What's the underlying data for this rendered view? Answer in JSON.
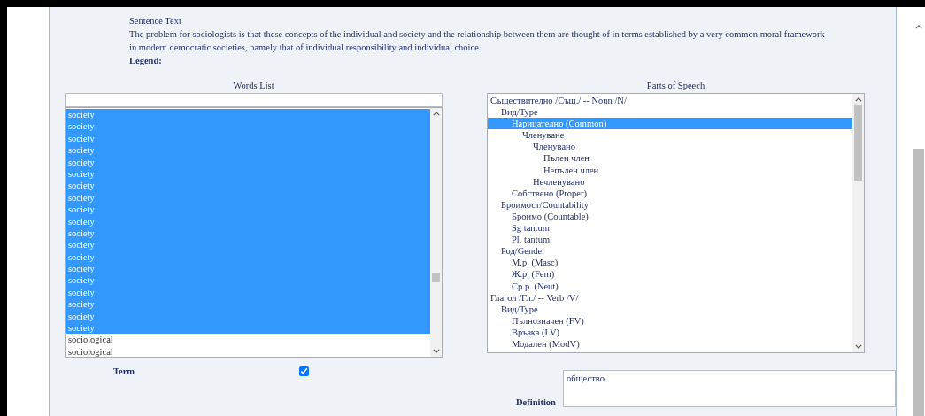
{
  "sentence": {
    "heading": "Sentence Text",
    "text": "The problem for sociologists is that these concepts of the individual and society and the relationship between them are thought of in terms established by a very common moral framework in modern democratic societies, namely that of individual responsibility and individual choice.",
    "legend_label": "Legend:"
  },
  "words_list": {
    "title": "Words List",
    "items": [
      {
        "label": "society",
        "selected": true
      },
      {
        "label": "society",
        "selected": true
      },
      {
        "label": "society",
        "selected": true
      },
      {
        "label": "society",
        "selected": true
      },
      {
        "label": "society",
        "selected": true
      },
      {
        "label": "society",
        "selected": true
      },
      {
        "label": "society",
        "selected": true
      },
      {
        "label": "society",
        "selected": true
      },
      {
        "label": "society",
        "selected": true
      },
      {
        "label": "society",
        "selected": true
      },
      {
        "label": "society",
        "selected": true
      },
      {
        "label": "society",
        "selected": true
      },
      {
        "label": "society",
        "selected": true
      },
      {
        "label": "society",
        "selected": true
      },
      {
        "label": "society",
        "selected": true
      },
      {
        "label": "society",
        "selected": true
      },
      {
        "label": "society",
        "selected": true
      },
      {
        "label": "society",
        "selected": true
      },
      {
        "label": "society",
        "selected": true
      },
      {
        "label": "sociological",
        "selected": false
      },
      {
        "label": "sociological",
        "selected": false
      }
    ]
  },
  "parts_of_speech": {
    "title": "Parts of Speech",
    "tree": [
      {
        "label": "Съществително /Същ./ -- Noun /N/",
        "selected": false,
        "children": [
          {
            "label": "Вид/Type",
            "selected": false,
            "children": [
              {
                "label": "Нарицателно (Common)",
                "selected": true,
                "children": [
                  {
                    "label": "Членуване",
                    "selected": false,
                    "children": [
                      {
                        "label": "Членувано",
                        "selected": false,
                        "children": [
                          {
                            "label": "Пълен член",
                            "selected": false
                          },
                          {
                            "label": "Непълен член",
                            "selected": false
                          }
                        ]
                      },
                      {
                        "label": "Нечленувано",
                        "selected": false
                      }
                    ]
                  }
                ]
              },
              {
                "label": "Собствено (Proper)",
                "selected": false
              }
            ]
          },
          {
            "label": "Броимост/Countability",
            "selected": false,
            "children": [
              {
                "label": "Броимо (Countable)",
                "selected": false
              },
              {
                "label": "Sg tantum",
                "selected": false
              },
              {
                "label": "Pl. tantum",
                "selected": false
              }
            ]
          },
          {
            "label": "Род/Gender",
            "selected": false,
            "children": [
              {
                "label": "М.р. (Masc)",
                "selected": false
              },
              {
                "label": "Ж.р. (Fem)",
                "selected": false
              },
              {
                "label": "Ср.р. (Neut)",
                "selected": false
              }
            ]
          }
        ]
      },
      {
        "label": "Глагол /Гл./ -- Verb /V/",
        "selected": false,
        "children": [
          {
            "label": "Вид/Type",
            "selected": false,
            "children": [
              {
                "label": "Пълнозначен (FV)",
                "selected": false
              },
              {
                "label": "Връзка (LV)",
                "selected": false
              },
              {
                "label": "Модален (ModV)",
                "selected": false
              }
            ]
          }
        ]
      }
    ]
  },
  "term": {
    "label": "Term",
    "checked": true
  },
  "definition": {
    "label": "Definition",
    "value": "общество"
  }
}
